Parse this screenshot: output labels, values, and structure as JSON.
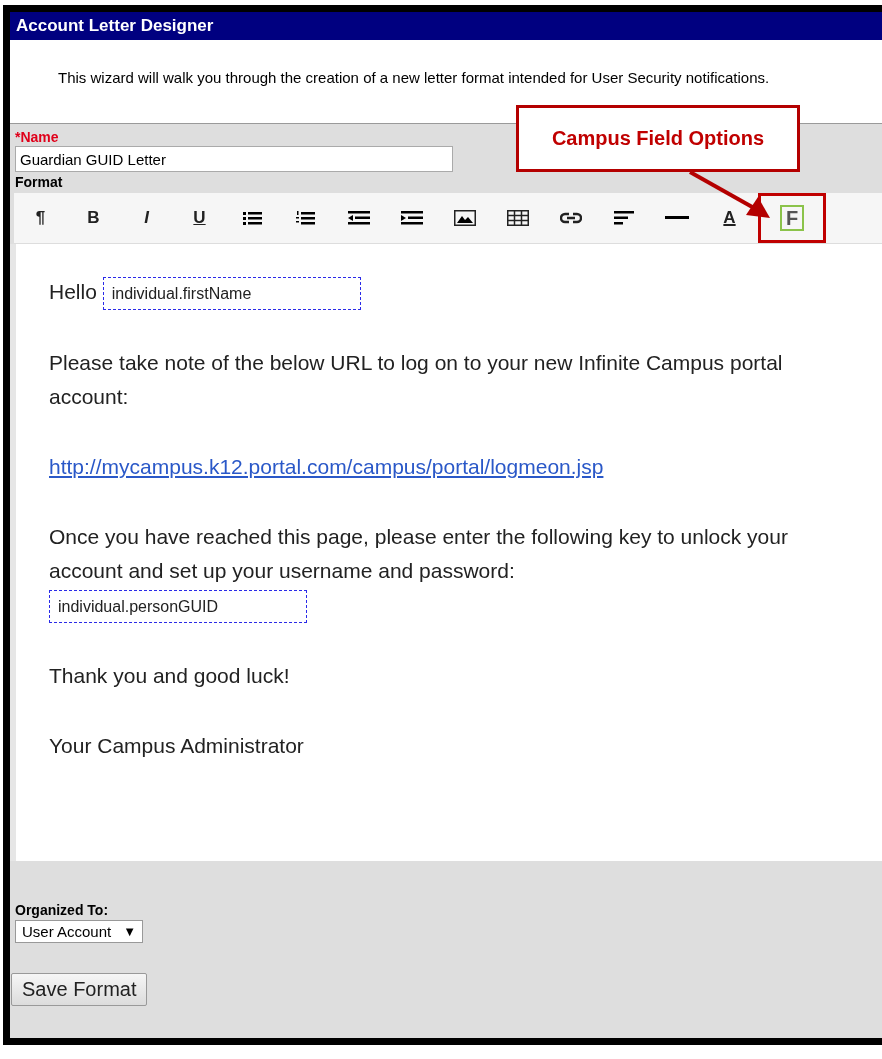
{
  "window": {
    "title": "Account Letter Designer"
  },
  "intro": "This wizard will walk you through the creation of a new letter format intended for User Security notifications.",
  "name_field": {
    "label": "*Name",
    "value": "Guardian GUID Letter"
  },
  "format_label": "Format",
  "toolbar": [
    {
      "kind": "paragraph",
      "text": "¶",
      "highlighted": false
    },
    {
      "kind": "bold",
      "text": "B",
      "highlighted": false
    },
    {
      "kind": "italic",
      "text": "I",
      "highlighted": false
    },
    {
      "kind": "underline",
      "text": "U",
      "highlighted": false
    },
    {
      "kind": "bullets",
      "highlighted": false
    },
    {
      "kind": "numbers",
      "highlighted": false
    },
    {
      "kind": "outdent",
      "highlighted": false
    },
    {
      "kind": "indent",
      "highlighted": false
    },
    {
      "kind": "image",
      "highlighted": false
    },
    {
      "kind": "table",
      "highlighted": false
    },
    {
      "kind": "link",
      "highlighted": false
    },
    {
      "kind": "align",
      "highlighted": false
    },
    {
      "kind": "rule",
      "highlighted": false
    },
    {
      "kind": "color",
      "text": "A",
      "highlighted": false
    },
    {
      "kind": "field",
      "text": "F",
      "highlighted": true
    }
  ],
  "callout": {
    "text": "Campus Field Options"
  },
  "editor": {
    "paragraphs": [
      [
        {
          "kind": "text",
          "text": "Hello"
        },
        {
          "kind": "field",
          "text": "individual.firstName"
        }
      ],
      [
        {
          "kind": "text",
          "text": "Please take note of the below URL to log on to your new Infinite Campus portal account:"
        }
      ],
      [
        {
          "kind": "link",
          "text": "http://mycampus.k12.portal.com/campus/portal/logmeon.jsp"
        }
      ],
      [
        {
          "kind": "text",
          "text": "Once you have reached this page, please enter the following key to unlock your account and set up your username and password:"
        },
        {
          "kind": "break"
        },
        {
          "kind": "field",
          "text": "individual.personGUID"
        }
      ],
      [
        {
          "kind": "text",
          "text": "Thank you and good luck!"
        }
      ],
      [
        {
          "kind": "text",
          "text": "Your Campus Administrator"
        }
      ]
    ]
  },
  "organized_to": {
    "label": "Organized To:",
    "value": "User Account",
    "caret": "▼"
  },
  "save_button": "Save Format"
}
